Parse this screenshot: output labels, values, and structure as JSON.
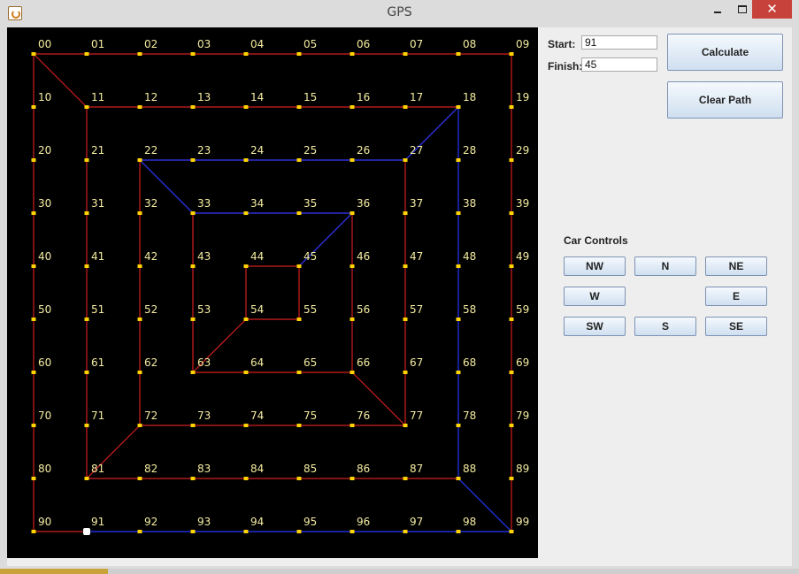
{
  "window": {
    "title": "GPS",
    "close_glyph": "✕"
  },
  "form": {
    "start_label": "Start:",
    "start_value": "91",
    "finish_label": "Finish:",
    "finish_value": "45",
    "calculate_label": "Calculate",
    "clear_label": "Clear Path"
  },
  "car_controls": {
    "title": "Car Controls",
    "buttons": [
      "NW",
      "N",
      "NE",
      "W",
      "E",
      "SW",
      "S",
      "SE"
    ]
  },
  "map": {
    "node_labels": [
      [
        "00",
        "01",
        "02",
        "03",
        "04",
        "05",
        "06",
        "07",
        "08",
        "09"
      ],
      [
        "10",
        "11",
        "12",
        "13",
        "14",
        "15",
        "16",
        "17",
        "18",
        "19"
      ],
      [
        "20",
        "21",
        "22",
        "23",
        "24",
        "25",
        "26",
        "27",
        "28",
        "29"
      ],
      [
        "30",
        "31",
        "32",
        "33",
        "34",
        "35",
        "36",
        "37",
        "38",
        "39"
      ],
      [
        "40",
        "41",
        "42",
        "43",
        "44",
        "45",
        "46",
        "47",
        "48",
        "49"
      ],
      [
        "50",
        "51",
        "52",
        "53",
        "54",
        "55",
        "56",
        "57",
        "58",
        "59"
      ],
      [
        "60",
        "61",
        "62",
        "63",
        "64",
        "65",
        "66",
        "67",
        "68",
        "69"
      ],
      [
        "70",
        "71",
        "72",
        "73",
        "74",
        "75",
        "76",
        "77",
        "78",
        "79"
      ],
      [
        "80",
        "81",
        "82",
        "83",
        "84",
        "85",
        "86",
        "87",
        "88",
        "89"
      ],
      [
        "90",
        "91",
        "92",
        "93",
        "94",
        "95",
        "96",
        "97",
        "98",
        "99"
      ]
    ],
    "current_node": "91",
    "colors": {
      "road": "#d21f1f",
      "path": "#1f2fd6",
      "node": "#ffd400",
      "label": "#f4eca0",
      "background": "#000000",
      "car": "#ffffff"
    },
    "roads": [
      [
        "00",
        "09"
      ],
      [
        "09",
        "99"
      ],
      [
        "00",
        "90"
      ],
      [
        "00",
        "11"
      ],
      [
        "90",
        "91"
      ],
      [
        "11",
        "18"
      ],
      [
        "11",
        "81"
      ],
      [
        "81",
        "88"
      ],
      [
        "81",
        "72"
      ],
      [
        "72",
        "77"
      ],
      [
        "72",
        "22"
      ],
      [
        "22",
        "27"
      ],
      [
        "27",
        "77"
      ],
      [
        "27",
        "18"
      ],
      [
        "33",
        "36"
      ],
      [
        "36",
        "66"
      ],
      [
        "63",
        "66"
      ],
      [
        "66",
        "77"
      ],
      [
        "33",
        "63"
      ],
      [
        "33",
        "22"
      ],
      [
        "44",
        "45"
      ],
      [
        "45",
        "55"
      ],
      [
        "54",
        "55"
      ],
      [
        "44",
        "54"
      ],
      [
        "54",
        "63"
      ],
      [
        "45",
        "36"
      ]
    ],
    "path_edges": [
      [
        "91",
        "99"
      ],
      [
        "99",
        "88"
      ],
      [
        "88",
        "18"
      ],
      [
        "18",
        "27"
      ],
      [
        "27",
        "22"
      ],
      [
        "22",
        "33"
      ],
      [
        "33",
        "36"
      ],
      [
        "36",
        "45"
      ]
    ]
  }
}
